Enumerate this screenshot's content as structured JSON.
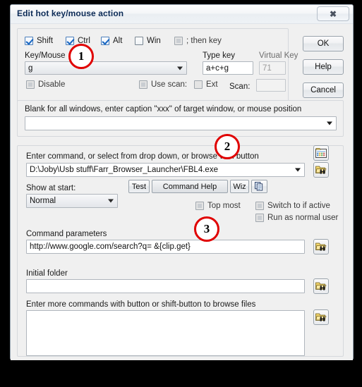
{
  "window": {
    "title": "Edit hot key/mouse action",
    "close_label": "✖"
  },
  "modifiers": [
    {
      "label": "Shift",
      "checked": false,
      "disabled": false
    },
    {
      "label": "Ctrl",
      "checked": true,
      "disabled": false
    },
    {
      "label": "Alt",
      "checked": true,
      "disabled": false
    },
    {
      "label": "Win",
      "checked": false,
      "disabled": false
    },
    {
      "label": "; then key",
      "checked": false,
      "disabled": true
    }
  ],
  "key_section": {
    "key_mouse_label": "Key/Mouse",
    "key_mouse_value": "g",
    "type_key_label": "Type key",
    "type_key_value": "a+c+g",
    "virtual_key_label": "Virtual Key",
    "virtual_key_value": "71",
    "disable_label": "Disable",
    "use_scan_label": "Use scan:",
    "ext_label": "Ext",
    "scan_label": "Scan:",
    "scan_value": ""
  },
  "buttons": {
    "ok": "OK",
    "help": "Help",
    "cancel": "Cancel"
  },
  "window_filter": {
    "label": "Blank for all windows, enter caption \"xxx\" of target window, or mouse position",
    "value": ""
  },
  "command": {
    "label": "Enter command, or select from drop down, or browse with button",
    "value": "D:\\Joby\\Usb stuff\\Farr_Browser_Launcher\\FBL4.exe",
    "test_label": "Test",
    "command_help_label": "Command Help",
    "wiz_label": "Wiz",
    "show_at_start_label": "Show at start:",
    "show_at_start_value": "Normal",
    "top_most_label": "Top most",
    "switch_to_if_active_label": "Switch to if active",
    "run_as_normal_user_label": "Run as normal user"
  },
  "parameters": {
    "label": "Command parameters",
    "value": "http://www.google.com/search?q= &{clip.get}"
  },
  "initial_folder": {
    "label": "Initial folder",
    "value": ""
  },
  "more_commands": {
    "label": "Enter more commands with button or shift-button to browse files",
    "value": ""
  },
  "annotations": [
    {
      "number": "1"
    },
    {
      "number": "2"
    },
    {
      "number": "3"
    }
  ],
  "colors": {
    "title_text": "#0c2b57",
    "annotation_red": "#e00000",
    "dialog_bg": "#f0f0f0",
    "field_bg": "#ffffff"
  }
}
